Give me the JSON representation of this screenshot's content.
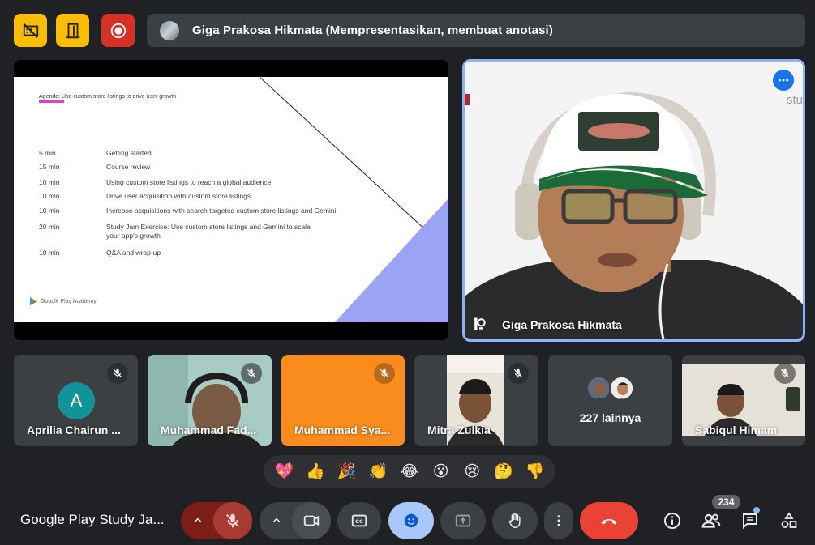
{
  "topbar": {
    "presenter_banner": "Giga Prakosa Hikmata (Mempresentasikan, membuat anotasi)",
    "buttons": [
      "no-video-icon",
      "door-icon",
      "record-icon"
    ]
  },
  "slide": {
    "header": "Agenda: Use custom store listings to drive user growth",
    "agenda": [
      {
        "time": "5 min",
        "topic": "Getting started"
      },
      {
        "time": "15 min",
        "topic": "Course review"
      },
      {
        "time": "10 min",
        "topic": "Using custom store listings to reach a global audience"
      },
      {
        "time": "10 min",
        "topic": "Drive user acquisition with custom store listings"
      },
      {
        "time": "10 min",
        "topic": "Increase acquisitions with search targeted custom store listings and Gemini"
      },
      {
        "time": "20 min",
        "topic": "Study Jam Exercise: Use custom store listings and Gemini to scale your app's growth"
      },
      {
        "time": "10 min",
        "topic": "Q&A and wrap-up"
      }
    ],
    "logo_text": "Google Play Academy"
  },
  "speaker": {
    "name": "Giga Prakosa Hikmata",
    "brand_peek": "stu"
  },
  "participants": [
    {
      "name": "Aprilia Chairun ...",
      "avatar_letter": "A"
    },
    {
      "name": "Muhammad Fad..."
    },
    {
      "name": "Muhammad Sya..."
    },
    {
      "name": "Mitra Zulkia"
    },
    {
      "name": "227 lainnya"
    },
    {
      "name": "Sabiqul Himam"
    }
  ],
  "reactions": [
    "💖",
    "👍",
    "🎉",
    "👏",
    "😂",
    "😮",
    "😢",
    "🤔",
    "👎"
  ],
  "bottom": {
    "meeting_title": "Google Play Study Ja...",
    "participant_count": "234"
  },
  "colors": {
    "background": "#202124",
    "tile": "#3c4043",
    "accent_blue": "#8ab4f8",
    "end_call_red": "#ea4335",
    "yellow": "#fbbc04",
    "orange_tile": "#fa8c1e"
  }
}
